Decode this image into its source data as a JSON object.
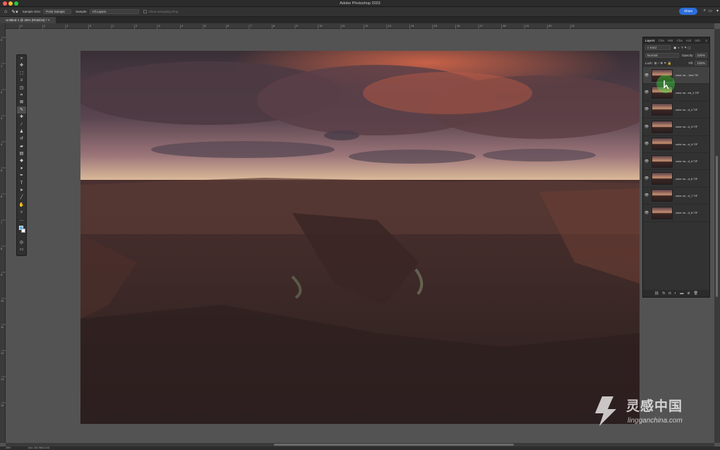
{
  "window": {
    "title": "Adobe Photoshop 2023",
    "share_label": "Share"
  },
  "options_bar": {
    "sample_size_label": "Sample Size:",
    "sample_size_value": "Point Sample",
    "sample_label": "Sample:",
    "sample_value": "All Layers",
    "show_ring_label": "Show Sampling Ring"
  },
  "document": {
    "tab_label": "Untitled-1 @ 25% (RGB/16) *"
  },
  "ruler": {
    "h_ticks": [
      "0",
      "2",
      "1",
      "0",
      "1",
      "2",
      "3",
      "4",
      "5",
      "6",
      "7",
      "8",
      "9",
      "10",
      "11",
      "12",
      "13",
      "14",
      "15",
      "16",
      "17",
      "18",
      "19",
      "20",
      "21"
    ],
    "v_ticks": [
      "0",
      "1",
      "2",
      "3",
      "4",
      "5",
      "6",
      "7",
      "8",
      "9",
      "10",
      "11",
      "12",
      "13",
      "14"
    ]
  },
  "layers_panel": {
    "tabs": [
      "Layers",
      "Cha",
      "Hist",
      "Cha",
      "Acti",
      "Info"
    ],
    "kind_label": "Kind",
    "blend_mode": "Normal",
    "opacity_label": "Opacity:",
    "opacity_value": "100%",
    "lock_label": "Lock:",
    "fill_label": "Fill:",
    "fill_value": "100%",
    "layers": [
      {
        "name": "color no... bed.TIF"
      },
      {
        "name": "color no...ed_1.TIF"
      },
      {
        "name": "color no...d_2.TIF"
      },
      {
        "name": "color no...d_3.TIF"
      },
      {
        "name": "color no...d_4.TIF"
      },
      {
        "name": "color no...d_5.TIF"
      },
      {
        "name": "color no...d_6.TIF"
      },
      {
        "name": "color no...d_7.TIF"
      },
      {
        "name": "color no...d_8.TIF"
      }
    ]
  },
  "status": {
    "zoom": "25%",
    "doc": "Doc: 331.9M/2.10G"
  },
  "watermark": {
    "text": "灵感中国",
    "url": "lingganchina.com"
  },
  "colors": {
    "accent": "#2c6fdc",
    "panel": "#323232",
    "workspace": "#535353"
  }
}
